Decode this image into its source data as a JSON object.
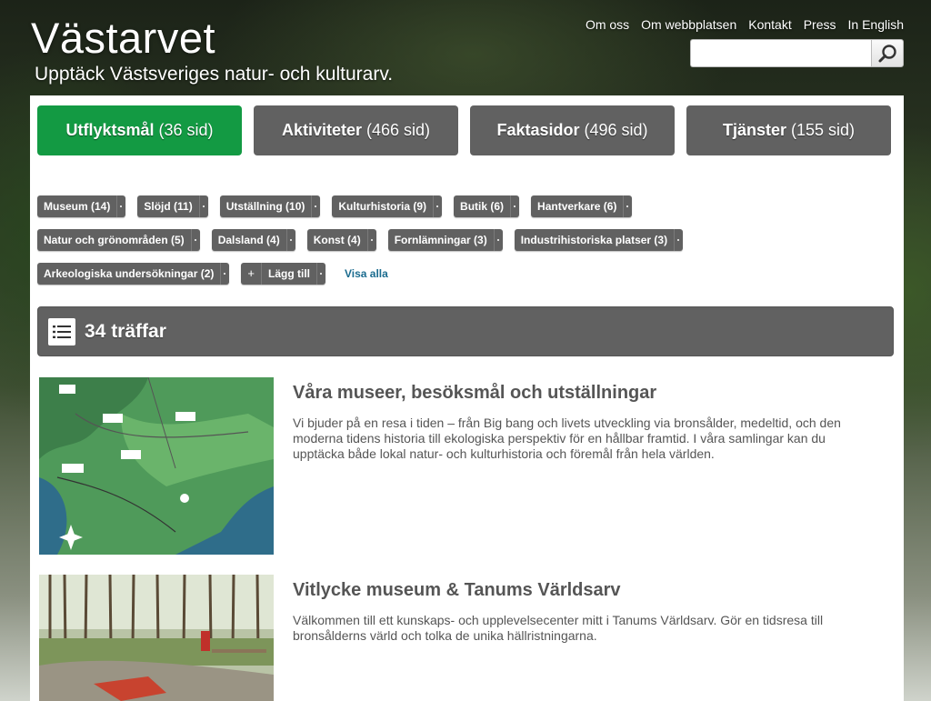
{
  "header": {
    "site_title": "Västarvet",
    "tagline": "Upptäck Västsveriges natur- och kulturarv.",
    "nav": [
      "Om oss",
      "Om webbplatsen",
      "Kontakt",
      "Press",
      "In English"
    ],
    "search": {
      "value": "",
      "placeholder": ""
    }
  },
  "categories": [
    {
      "name": "Utflyktsmål",
      "count": "(36 sid)",
      "active": true
    },
    {
      "name": "Aktiviteter",
      "count": "(466 sid)",
      "active": false
    },
    {
      "name": "Faktasidor",
      "count": "(496 sid)",
      "active": false
    },
    {
      "name": "Tjänster",
      "count": "(155 sid)",
      "active": false
    }
  ],
  "tags": {
    "row1": [
      "Museum (14)",
      "Slöjd (11)",
      "Utställning (10)",
      "Kulturhistoria (9)",
      "Butik (6)",
      "Hantverkare (6)"
    ],
    "row2": [
      "Natur och grönområden (5)",
      "Dalsland (4)",
      "Konst (4)",
      "Fornlämningar (3)",
      "Industrihistoriska platser (3)"
    ],
    "row3": [
      "Arkeologiska undersökningar (2)"
    ],
    "add_label": "Lägg till",
    "add_symbol": "+",
    "show_all": "Visa alla"
  },
  "results": {
    "count_label": "34 träffar",
    "items": [
      {
        "title": "Våra museer, besöksmål och utställningar",
        "description": "Vi bjuder på en resa i tiden – från Big bang och livets utveckling via bronsålder, medeltid, och den moderna tidens historia till ekologiska perspektiv för en hållbar framtid. I våra samlingar kan du upptäcka både lokal natur- och kulturhistoria och föremål från hela världen."
      },
      {
        "title": "Vitlycke museum & Tanums Världsarv",
        "description": "Välkommen till ett kunskaps- och upplevelsecenter mitt i Tanums Världsarv. Gör en tidsresa till bronsålderns värld och tolka de unika hällristningarna."
      }
    ]
  },
  "colors": {
    "active_tab": "#139a43",
    "tab_gray": "#616161",
    "link_blue": "#1b6c8f",
    "text_gray": "#555555"
  },
  "icons": [
    "search-icon",
    "list-icon"
  ]
}
